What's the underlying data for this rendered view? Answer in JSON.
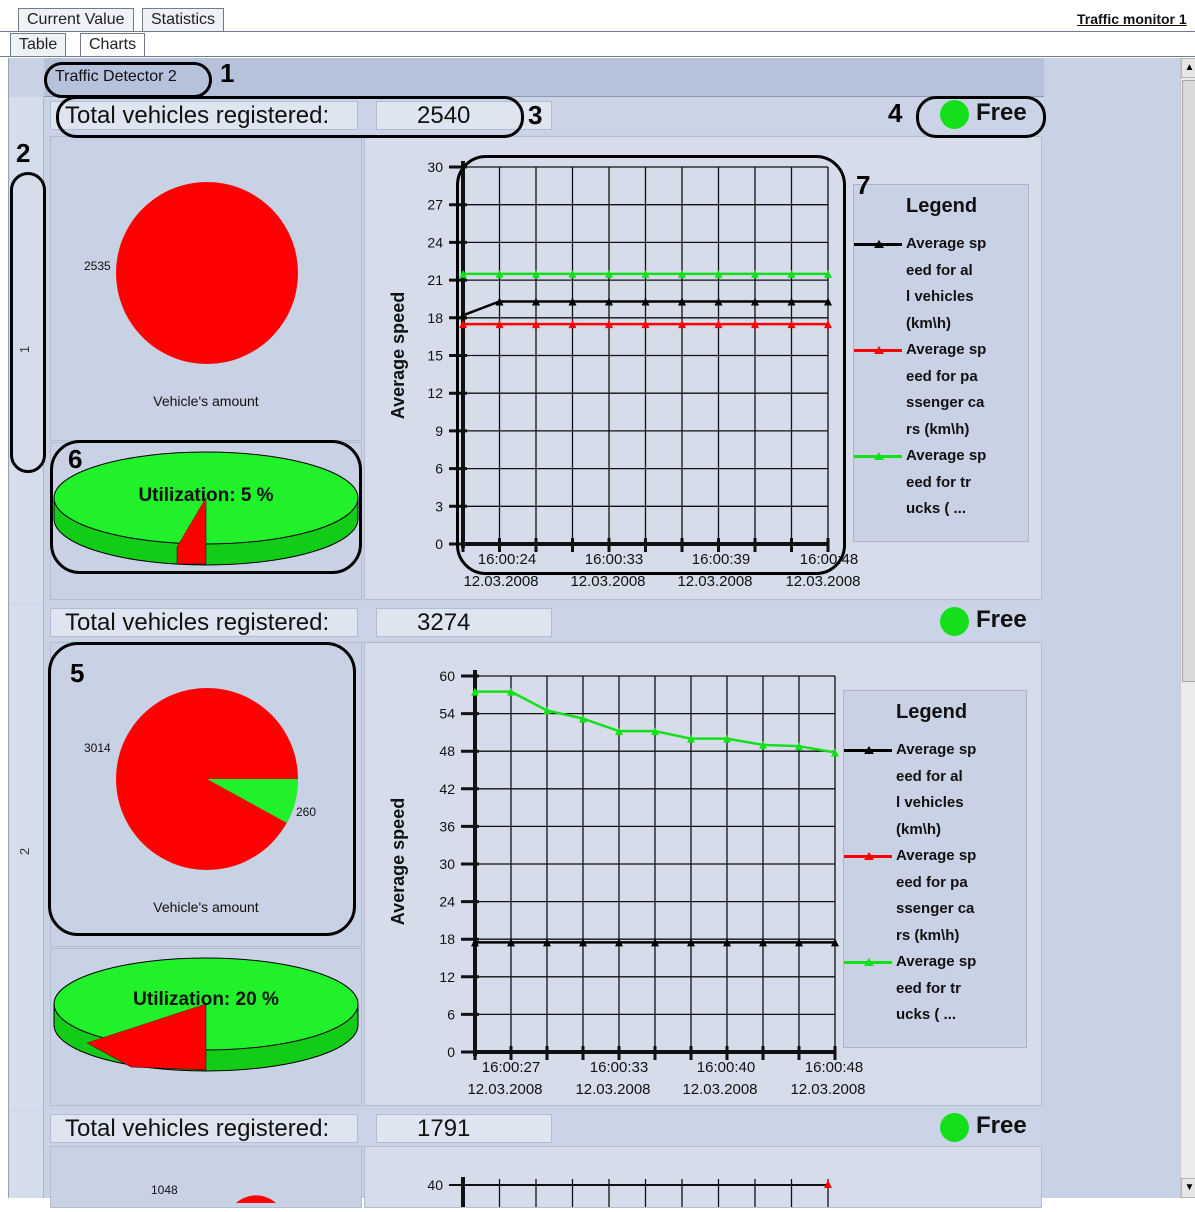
{
  "tabs": {
    "top": [
      "Current Value",
      "Statistics"
    ],
    "second": [
      "Table",
      "Charts"
    ],
    "window_link": "Traffic monitor 1"
  },
  "detector_title": "Traffic Detector 2",
  "row_labels": [
    "1",
    "2"
  ],
  "callouts": [
    "1",
    "2",
    "3",
    "4",
    "5",
    "6",
    "7"
  ],
  "status_text": "Free",
  "colors": {
    "green": "#13e01a",
    "red": "#ff0000",
    "black": "#000000"
  },
  "sections": [
    {
      "total_label": "Total vehicles registered:",
      "total_value": "2540",
      "status": "Free",
      "pie_label": "Vehicle's amount",
      "pie_values": [
        "2535",
        ""
      ],
      "util_label": "Utilization: 5 %",
      "util_percent": 5,
      "ylabel": "Average speed",
      "legend_title": "Legend",
      "legend": [
        [
          "Average sp",
          "eed for al",
          "l vehicles",
          " (km\\h)"
        ],
        [
          "Average sp",
          "eed for pa",
          "ssenger ca",
          "rs (km\\h)"
        ],
        [
          "Average sp",
          "eed for tr",
          "ucks ( ..."
        ]
      ],
      "yticks": [
        "0",
        "3",
        "6",
        "9",
        "12",
        "15",
        "18",
        "21",
        "24",
        "27",
        "30"
      ],
      "xticks": [
        [
          "16:00:24",
          "12.03.2008"
        ],
        [
          "16:00:33",
          "12.03.2008"
        ],
        [
          "16:00:39",
          "12.03.2008"
        ],
        [
          "16:00:48",
          "12.03.2008"
        ]
      ]
    },
    {
      "total_label": "Total vehicles registered:",
      "total_value": "3274",
      "status": "Free",
      "pie_label": "Vehicle's amount",
      "pie_values": [
        "3014",
        "260"
      ],
      "util_label": "Utilization: 20 %",
      "util_percent": 20,
      "ylabel": "Average speed",
      "legend_title": "Legend",
      "legend": [
        [
          "Average sp",
          "eed for al",
          "l vehicles",
          " (km\\h)"
        ],
        [
          "Average sp",
          "eed for pa",
          "ssenger ca",
          "rs (km\\h)"
        ],
        [
          "Average sp",
          "eed for tr",
          "ucks ( ..."
        ]
      ],
      "yticks": [
        "0",
        "6",
        "12",
        "18",
        "24",
        "30",
        "36",
        "42",
        "48",
        "54",
        "60"
      ],
      "xticks": [
        [
          "16:00:27",
          "12.03.2008"
        ],
        [
          "16:00:33",
          "12.03.2008"
        ],
        [
          "16:00:40",
          "12.03.2008"
        ],
        [
          "16:00:48",
          "12.03.2008"
        ]
      ]
    },
    {
      "total_label": "Total vehicles registered:",
      "total_value": "1791",
      "status": "Free",
      "pie_values": [
        "1048"
      ],
      "yticks": [
        "40"
      ]
    }
  ]
}
